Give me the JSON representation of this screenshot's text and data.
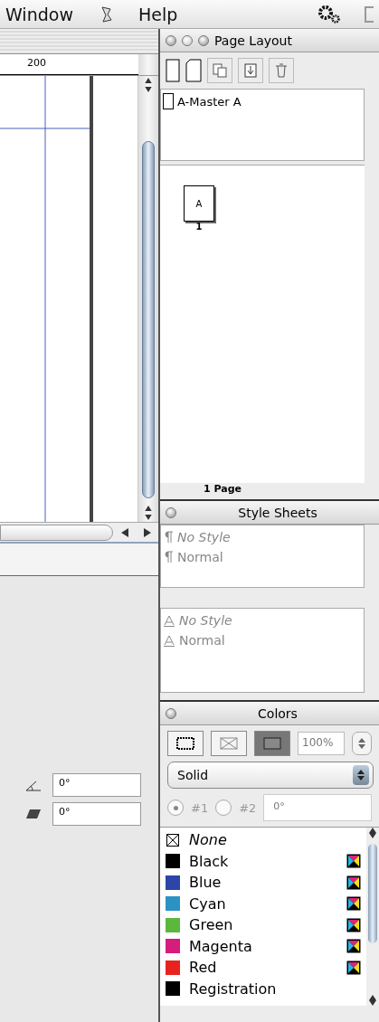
{
  "menu_bar": {
    "items": [
      "Window",
      "Help"
    ]
  },
  "document": {
    "ruler": {
      "label": "200"
    },
    "measurements": {
      "angle": "0°",
      "skew": "0°"
    }
  },
  "page_layout": {
    "title": "Page Layout",
    "masters": [
      "A-Master A"
    ],
    "pages": [
      {
        "master": "A",
        "number": "1"
      }
    ],
    "footer": "1 Page"
  },
  "style_sheets": {
    "title": "Style Sheets",
    "paragraph": [
      {
        "name": "No Style",
        "kind": "none"
      },
      {
        "name": "Normal",
        "kind": "style"
      }
    ],
    "character": [
      {
        "name": "No Style",
        "kind": "none"
      },
      {
        "name": "Normal",
        "kind": "style"
      }
    ]
  },
  "colors": {
    "title": "Colors",
    "modes": [
      {
        "kind": "frame",
        "selected": false
      },
      {
        "kind": "text",
        "selected": false
      },
      {
        "kind": "background",
        "selected": true
      }
    ],
    "shade": "100%",
    "fill": "Solid",
    "radios": [
      {
        "label": "#1",
        "selected": true
      },
      {
        "label": "#2",
        "selected": false
      }
    ],
    "angle": "0°",
    "items": [
      {
        "name": "None",
        "kind": "none"
      },
      {
        "name": "Black",
        "kind": "swatch",
        "color": "#000000",
        "process": true
      },
      {
        "name": "Blue",
        "kind": "swatch",
        "color": "#2c45a8",
        "process": true
      },
      {
        "name": "Cyan",
        "kind": "swatch",
        "color": "#2a93c4",
        "process": true
      },
      {
        "name": "Green",
        "kind": "swatch",
        "color": "#5cb83c",
        "process": true
      },
      {
        "name": "Magenta",
        "kind": "swatch",
        "color": "#d61c7c",
        "process": true
      },
      {
        "name": "Red",
        "kind": "swatch",
        "color": "#e8231f",
        "process": true
      },
      {
        "name": "Registration",
        "kind": "swatch",
        "color": "#000000",
        "process": false
      }
    ]
  }
}
